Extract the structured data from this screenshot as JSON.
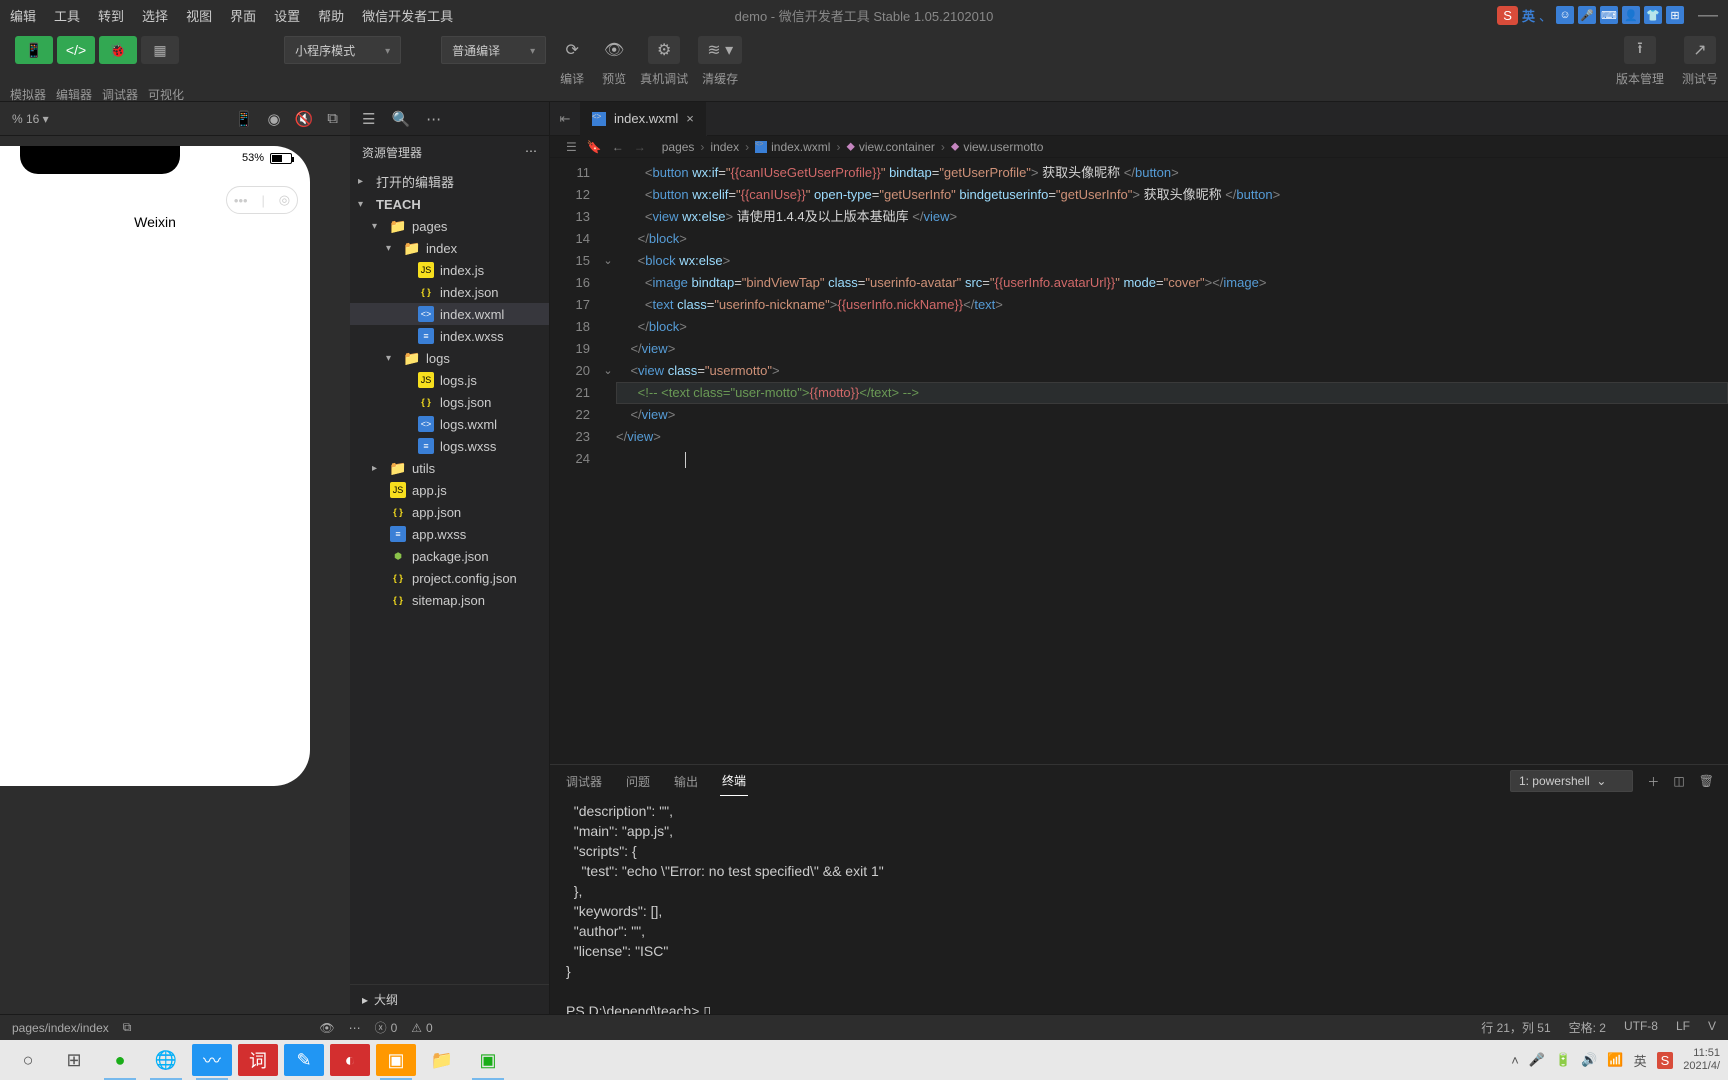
{
  "titlebar": {
    "menus": [
      "编辑",
      "工具",
      "转到",
      "选择",
      "视图",
      "界面",
      "设置",
      "帮助",
      "微信开发者工具"
    ],
    "title": "demo - 微信开发者工具 Stable 1.05.2102010",
    "ime": "S",
    "lang": "英"
  },
  "toolbar": {
    "labels": {
      "sim": "模拟器",
      "editor": "编辑器",
      "debug": "调试器",
      "viz": "可视化"
    },
    "mode": "小程序模式",
    "compile": "普通编译",
    "actions": {
      "compile": "编译",
      "preview": "预览",
      "remote": "真机调试",
      "cache": "清缓存"
    },
    "right": {
      "vcs": "版本管理",
      "test": "测试号"
    }
  },
  "simulator": {
    "zoom": "% 16 ▾",
    "battery": "53%",
    "app_name": "Weixin",
    "path": "pages/index/index"
  },
  "explorer": {
    "title": "资源管理器",
    "sections": {
      "open": "打开的编辑器",
      "root": "TEACH"
    },
    "tree": {
      "pages": "pages",
      "index": "index",
      "index_js": "index.js",
      "index_json": "index.json",
      "index_wxml": "index.wxml",
      "index_wxss": "index.wxss",
      "logs": "logs",
      "logs_js": "logs.js",
      "logs_json": "logs.json",
      "logs_wxml": "logs.wxml",
      "logs_wxss": "logs.wxss",
      "utils": "utils",
      "app_js": "app.js",
      "app_json": "app.json",
      "app_wxss": "app.wxss",
      "package": "package.json",
      "project": "project.config.json",
      "sitemap": "sitemap.json"
    },
    "outline": "大纲"
  },
  "editor": {
    "tab": "index.wxml",
    "breadcrumb": {
      "p1": "pages",
      "p2": "index",
      "p3": "index.wxml",
      "p4": "view.container",
      "p5": "view.usermotto"
    },
    "lines": {
      "11": "<button wx:if=\"{{canIUseGetUserProfile}}\" bindtap=\"getUserProfile\"> 获取头像昵称 </button>",
      "12": "<button wx:elif=\"{{canIUse}}\" open-type=\"getUserInfo\" bindgetuserinfo=\"getUserInfo\"> 获取头像昵称 </button>",
      "13": "<view wx:else> 请使用1.4.4及以上版本基础库 </view>",
      "14": "</block>",
      "15": "<block wx:else>",
      "16": "<image bindtap=\"bindViewTap\" class=\"userinfo-avatar\" src=\"{{userInfo.avatarUrl}}\" mode=\"cover\"></image>",
      "17": "<text class=\"userinfo-nickname\">{{userInfo.nickName}}</text>",
      "18": "</block>",
      "19": "</view>",
      "20": "<view class=\"usermotto\">",
      "21": "<!-- <text class=\"user-motto\">{{motto}}</text> -->",
      "22": "</view>",
      "23": "</view>"
    }
  },
  "panel": {
    "tabs": {
      "debug": "调试器",
      "problems": "问题",
      "output": "输出",
      "terminal": "终端"
    },
    "shell": "1: powershell",
    "out": [
      "  \"description\": \"\",",
      "  \"main\": \"app.js\",",
      "  \"scripts\": {",
      "    \"test\": \"echo \\\"Error: no test specified\\\" && exit 1\"",
      "  },",
      "  \"keywords\": [],",
      "  \"author\": \"\",",
      "  \"license\": \"ISC\"",
      "}",
      "",
      "PS D:\\depend\\teach> ▯"
    ]
  },
  "status": {
    "errors": "0",
    "warnings": "0",
    "pos": "行 21，列 51",
    "spaces": "空格: 2",
    "enc": "UTF-8",
    "eol": "LF",
    "lang": "V"
  },
  "taskbar": {
    "time": "11:51",
    "date": "2021/4/",
    "ime": "英"
  }
}
